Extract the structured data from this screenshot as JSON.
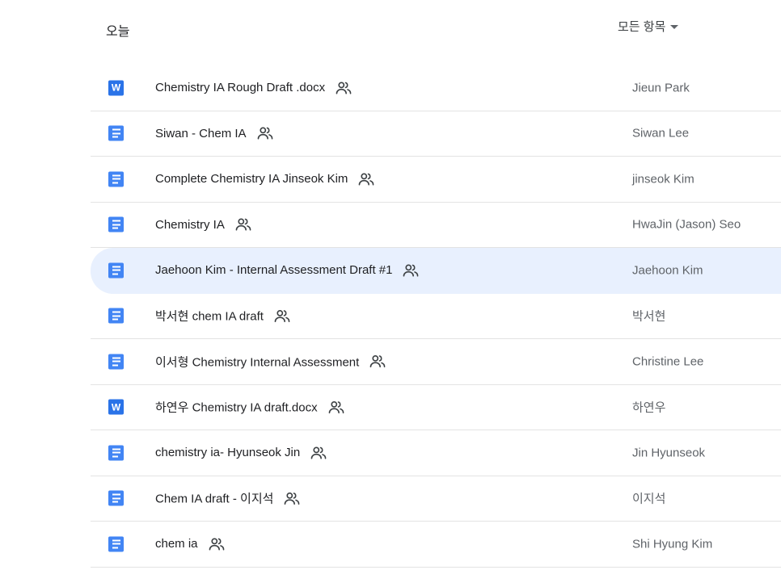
{
  "section": {
    "title": "오늘",
    "filter_label": "모든 항목"
  },
  "files": [
    {
      "name": "Chemistry IA Rough Draft .docx",
      "type": "word",
      "owner": "Jieun Park",
      "shared": true,
      "selected": false
    },
    {
      "name": "Siwan - Chem IA",
      "type": "docs",
      "owner": "Siwan Lee",
      "shared": true,
      "selected": false
    },
    {
      "name": "Complete Chemistry IA Jinseok Kim",
      "type": "docs",
      "owner": "jinseok Kim",
      "shared": true,
      "selected": false
    },
    {
      "name": "Chemistry IA",
      "type": "docs",
      "owner": "HwaJin (Jason) Seo",
      "shared": true,
      "selected": false
    },
    {
      "name": "Jaehoon Kim - Internal Assessment Draft #1",
      "type": "docs",
      "owner": "Jaehoon Kim",
      "shared": true,
      "selected": true
    },
    {
      "name": "박서현 chem IA draft",
      "type": "docs",
      "owner": "박서현",
      "shared": true,
      "selected": false
    },
    {
      "name": "이서형 Chemistry Internal Assessment",
      "type": "docs",
      "owner": "Christine Lee",
      "shared": true,
      "selected": false
    },
    {
      "name": "하연우 Chemistry IA draft.docx",
      "type": "word",
      "owner": "하연우",
      "shared": true,
      "selected": false
    },
    {
      "name": "chemistry ia- Hyunseok Jin",
      "type": "docs",
      "owner": "Jin Hyunseok",
      "shared": true,
      "selected": false
    },
    {
      "name": "Chem IA draft - 이지석",
      "type": "docs",
      "owner": "이지석",
      "shared": true,
      "selected": false
    },
    {
      "name": "chem ia",
      "type": "docs",
      "owner": "Shi Hyung Kim",
      "shared": true,
      "selected": false
    }
  ],
  "icons": {
    "docs": "google-docs-icon",
    "word": "word-doc-icon",
    "word_letter": "W",
    "shared": "shared-people-icon"
  },
  "colors": {
    "docs_blue": "#4285f4",
    "word_blue": "#2a73e8",
    "selected_bg": "#e8f0fe",
    "divider": "#e3e3e3"
  }
}
